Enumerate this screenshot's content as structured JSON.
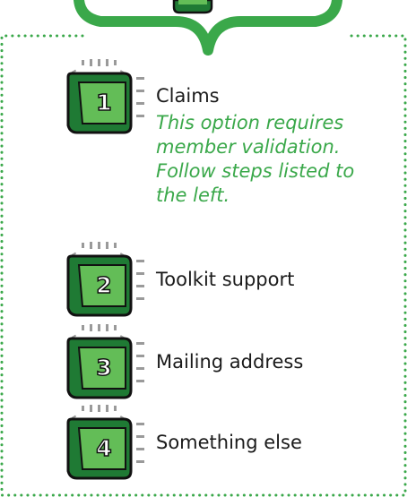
{
  "colors": {
    "accent_green": "#3aa84a",
    "key_face": "#63bd57",
    "key_side": "#1f7a34",
    "outline": "#111111",
    "burst": "#9a9a9a"
  },
  "options": [
    {
      "number": "1",
      "label": "Claims",
      "note": "This option requires\nmember validation.\nFollow steps listed to\nthe left."
    },
    {
      "number": "2",
      "label": "Toolkit support"
    },
    {
      "number": "3",
      "label": "Mailing address"
    },
    {
      "number": "4",
      "label": "Something else"
    }
  ]
}
